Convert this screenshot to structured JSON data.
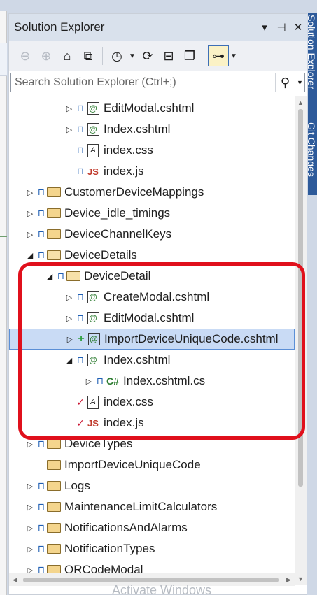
{
  "panel": {
    "title": "Solution Explorer",
    "title_buttons": [
      "▾",
      "⊣",
      "✕"
    ]
  },
  "toolbar": {
    "buttons": [
      {
        "name": "back-icon",
        "glyph": "⊖",
        "enabled": false
      },
      {
        "name": "forward-icon",
        "glyph": "⊕",
        "enabled": false
      },
      {
        "name": "home-icon",
        "glyph": "⌂",
        "enabled": true
      },
      {
        "name": "switch-views-icon",
        "glyph": "⧉",
        "enabled": true
      },
      {
        "name": "pending-changes-filter-icon",
        "glyph": "◷",
        "enabled": true
      },
      {
        "name": "sync-icon",
        "glyph": "⟳",
        "enabled": true
      },
      {
        "name": "collapse-all-icon",
        "glyph": "⊟",
        "enabled": true
      },
      {
        "name": "show-all-files-icon",
        "glyph": "❐",
        "enabled": true
      },
      {
        "name": "preview-selected-icon",
        "glyph": "⊶",
        "enabled": true
      }
    ]
  },
  "search": {
    "placeholder": "Search Solution Explorer (Ctrl+;)"
  },
  "side_tabs": [
    "Solution Explorer",
    "Git Changes"
  ],
  "tree": [
    {
      "label": "EditModal.cshtml",
      "icon": "razor",
      "badge": "lock",
      "expander": "collapsed",
      "indent": 3
    },
    {
      "label": "Index.cshtml",
      "icon": "razor",
      "badge": "lock",
      "expander": "collapsed",
      "indent": 3
    },
    {
      "label": "index.css",
      "icon": "css",
      "badge": "lock",
      "expander": "none",
      "indent": 3
    },
    {
      "label": "index.js",
      "icon": "js",
      "badge": "lock",
      "expander": "none",
      "indent": 3
    },
    {
      "label": "CustomerDeviceMappings",
      "icon": "folder",
      "badge": "lock",
      "expander": "collapsed",
      "indent": 0
    },
    {
      "label": "Device_idle_timings",
      "icon": "folder",
      "badge": "lock",
      "expander": "collapsed",
      "indent": 0
    },
    {
      "label": "DeviceChannelKeys",
      "icon": "folder",
      "badge": "lock",
      "expander": "collapsed",
      "indent": 0
    },
    {
      "label": "DeviceDetails",
      "icon": "folder-open",
      "badge": "lock",
      "expander": "expanded",
      "indent": 0
    },
    {
      "label": "DeviceDetail",
      "icon": "folder-open",
      "badge": "lock",
      "expander": "expanded",
      "indent": 1
    },
    {
      "label": "CreateModal.cshtml",
      "icon": "razor",
      "badge": "lock",
      "expander": "collapsed",
      "indent": 3
    },
    {
      "label": "EditModal.cshtml",
      "icon": "razor",
      "badge": "lock",
      "expander": "collapsed",
      "indent": 3
    },
    {
      "label": "ImportDeviceUniqueCode.cshtml",
      "icon": "razor",
      "badge": "plus",
      "expander": "collapsed",
      "indent": 3,
      "selected": true
    },
    {
      "label": "Index.cshtml",
      "icon": "razor",
      "badge": "lock",
      "expander": "expanded",
      "indent": 3
    },
    {
      "label": "Index.cshtml.cs",
      "icon": "cs",
      "badge": "lock",
      "expander": "collapsed",
      "indent": 4
    },
    {
      "label": "index.css",
      "icon": "css",
      "badge": "check",
      "expander": "none",
      "indent": 3
    },
    {
      "label": "index.js",
      "icon": "js",
      "badge": "check",
      "expander": "none",
      "indent": 3
    },
    {
      "label": "DeviceTypes",
      "icon": "folder",
      "badge": "lock",
      "expander": "collapsed",
      "indent": 0
    },
    {
      "label": "ImportDeviceUniqueCode",
      "icon": "folder",
      "badge": "none",
      "expander": "none",
      "indent": 0
    },
    {
      "label": "Logs",
      "icon": "folder",
      "badge": "lock",
      "expander": "collapsed",
      "indent": 0
    },
    {
      "label": "MaintenanceLimitCalculators",
      "icon": "folder",
      "badge": "lock",
      "expander": "collapsed",
      "indent": 0
    },
    {
      "label": "NotificationsAndAlarms",
      "icon": "folder",
      "badge": "lock",
      "expander": "collapsed",
      "indent": 0
    },
    {
      "label": "NotificationTypes",
      "icon": "folder",
      "badge": "lock",
      "expander": "collapsed",
      "indent": 0
    },
    {
      "label": "QRCodeModal",
      "icon": "folder",
      "badge": "lock",
      "expander": "collapsed",
      "indent": 0
    }
  ],
  "watermark": "Activate Windows",
  "colors": {
    "highlight_box": "#e0101c",
    "selection": "#c9dbf5",
    "lock_badge": "#1f5fb4",
    "check_badge": "#c8102e",
    "add_badge": "#2e9e3e"
  }
}
